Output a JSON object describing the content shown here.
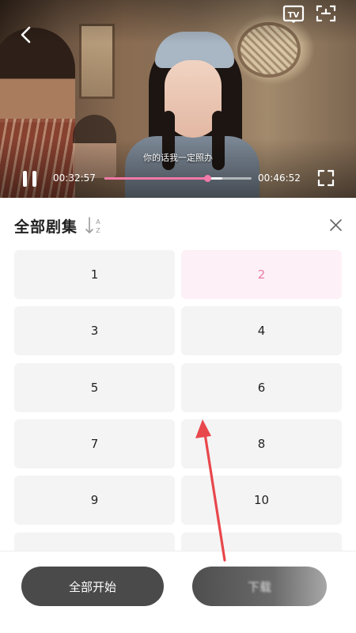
{
  "player": {
    "subtitle": "你的话我一定照办",
    "current_time": "00:32:57",
    "total_time": "00:46:52",
    "progress_fraction": 0.7,
    "buffer_fraction": 0.8,
    "accent_color": "#f279a8",
    "icons": [
      "back-icon",
      "tv-cast-icon",
      "scan-icon",
      "pause-icon",
      "fullscreen-icon"
    ]
  },
  "episodes_panel": {
    "title": "全部剧集",
    "sort_icon": "sort-az-icon",
    "close_icon": "close-icon",
    "selected_episode": "2",
    "selected_color": "#ea7aa7",
    "episodes": [
      "1",
      "2",
      "3",
      "4",
      "5",
      "6",
      "7",
      "8",
      "9",
      "10",
      "",
      ""
    ]
  },
  "actions": {
    "start_all_label": "全部开始",
    "download_label": "下载"
  },
  "annotation": {
    "arrow_color": "#e8474c"
  }
}
